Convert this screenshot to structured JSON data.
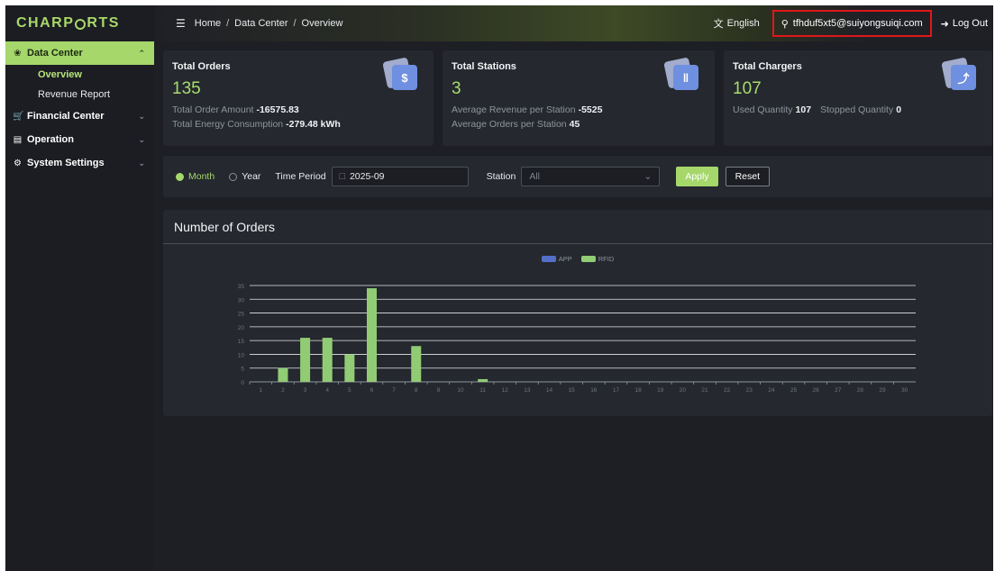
{
  "app": {
    "logo_pre": "CHARP",
    "logo_post": "RTS"
  },
  "sidebar": {
    "items": [
      {
        "label": "Data Center",
        "icon": "dashboard-icon",
        "expanded": true,
        "children": [
          {
            "label": "Overview"
          },
          {
            "label": "Revenue Report"
          }
        ]
      },
      {
        "label": "Financial Center",
        "icon": "cart-icon"
      },
      {
        "label": "Operation",
        "icon": "monitor-icon"
      },
      {
        "label": "System Settings",
        "icon": "gear-icon"
      }
    ]
  },
  "header": {
    "breadcrumb": [
      "Home",
      "Data Center",
      "Overview"
    ],
    "language": "English",
    "user": "tfhduf5xt5@suiyongsuiqi.com",
    "logout": "Log Out"
  },
  "cards": [
    {
      "title": "Total Orders",
      "value": "135",
      "lines": [
        {
          "label": "Total Order Amount",
          "value": "-16575.83"
        },
        {
          "label": "Total Energy Consumption",
          "value": "-279.48 kWh"
        }
      ],
      "icon": "dollar-icon"
    },
    {
      "title": "Total Stations",
      "value": "3",
      "lines": [
        {
          "label": "Average Revenue per Station",
          "value": "-5525"
        },
        {
          "label": "Average Orders per Station",
          "value": "45"
        }
      ],
      "icon": "bar-chart-icon"
    },
    {
      "title": "Total Chargers",
      "value": "107",
      "lines": [
        {
          "label": "Used Quantity",
          "value": "107",
          "label2": "Stopped Quantity",
          "value2": "0"
        }
      ],
      "icon": "lightning-icon"
    }
  ],
  "filter": {
    "month_label": "Month",
    "year_label": "Year",
    "time_period_label": "Time Period",
    "time_period_value": "2025-09",
    "station_label": "Station",
    "station_placeholder": "All",
    "apply": "Apply",
    "reset": "Reset"
  },
  "chart_panel": {
    "title": "Number of Orders"
  },
  "colors": {
    "accent": "#a5d76b",
    "app_series": "#5470c6",
    "rfid_series": "#91cc75"
  },
  "chart_data": {
    "type": "bar",
    "categories": [
      "1",
      "2",
      "3",
      "4",
      "5",
      "6",
      "7",
      "8",
      "9",
      "10",
      "11",
      "12",
      "13",
      "14",
      "15",
      "16",
      "17",
      "18",
      "19",
      "20",
      "21",
      "22",
      "23",
      "24",
      "25",
      "26",
      "27",
      "28",
      "29",
      "30"
    ],
    "series": [
      {
        "name": "APP",
        "values": [
          0,
          0,
          0,
          0,
          0,
          0,
          0,
          0,
          0,
          0,
          0,
          0,
          0,
          0,
          0,
          0,
          0,
          0,
          0,
          0,
          0,
          0,
          0,
          0,
          0,
          0,
          0,
          0,
          0,
          0
        ]
      },
      {
        "name": "RFID",
        "values": [
          0,
          5,
          16,
          16,
          10,
          34,
          0,
          13,
          0,
          0,
          1,
          0,
          0,
          0,
          0,
          0,
          0,
          0,
          0,
          0,
          0,
          0,
          0,
          0,
          0,
          0,
          0,
          0,
          0,
          0
        ]
      }
    ],
    "ylim": [
      0,
      35
    ],
    "yticks": [
      0,
      5,
      10,
      15,
      20,
      25,
      30,
      35
    ],
    "legend": "top-center",
    "grid": true
  }
}
